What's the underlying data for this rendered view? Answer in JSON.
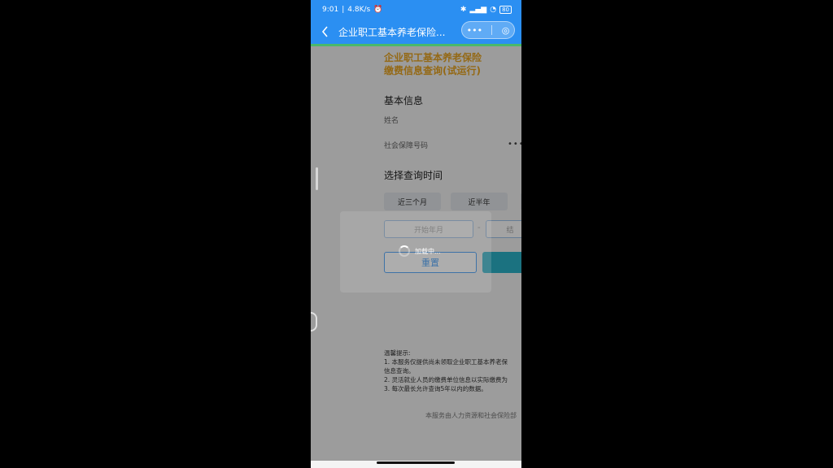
{
  "status_bar": {
    "time": "9:01",
    "speed": "4.8K/s",
    "battery": "80"
  },
  "nav": {
    "title": "企业职工基本养老保险...",
    "back_icon": "chevron-left-icon",
    "more_icon": "•••",
    "close_icon": "◎"
  },
  "page": {
    "heading_line1": "企业职工基本养老保险",
    "heading_line2": "缴费信息查询(试运行)",
    "basic_info": "基本信息",
    "name_label": "姓名",
    "ssn_label": "社会保障号码",
    "ssn_value": "••••",
    "time_section": "选择查询时间",
    "chips": [
      "近三个月",
      "近半年"
    ],
    "start_placeholder": "开始年月",
    "end_placeholder": "结",
    "dash": "-",
    "reset_label": "重置",
    "tips": [
      "温馨提示:",
      "1. 本服务仅提供尚未领取企业职工基本养老保",
      "信息查询。",
      "2. 灵活就业人员的缴费单位信息以实际缴费为",
      "3. 每次最长允许查询5年以内的数据。"
    ],
    "footer": "本服务由人力资源和社会保险部"
  },
  "loading": {
    "text": "加载中..."
  },
  "colors": {
    "primary": "#2b8ff2",
    "accent_heading": "#e8a421",
    "query_button": "#2bb3c8"
  }
}
